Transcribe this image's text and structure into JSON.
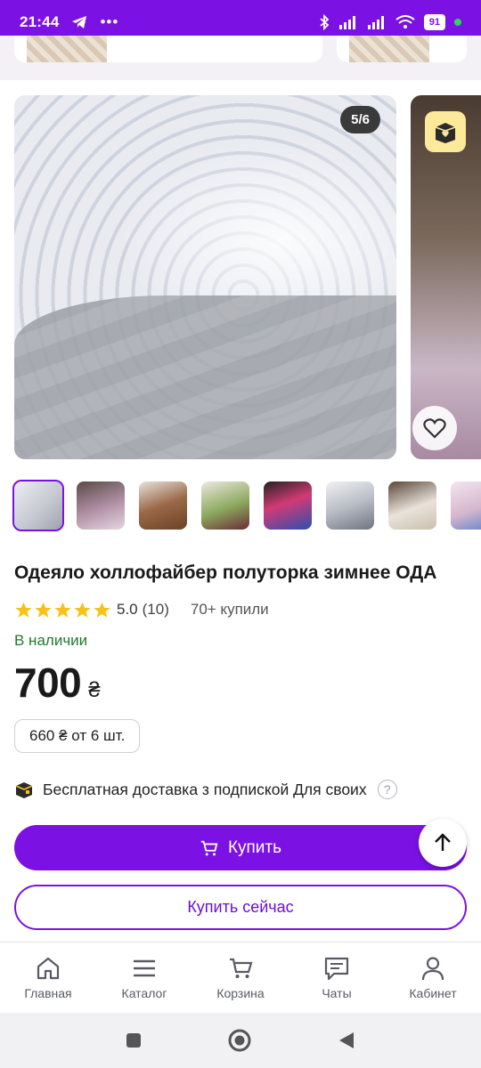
{
  "status_bar": {
    "time": "21:44",
    "battery": "91"
  },
  "gallery": {
    "counter": "5/6",
    "thumbnails": [
      {
        "color": "#d5d7de"
      },
      {
        "color": "#8d6f7f"
      },
      {
        "color": "#8a5a3f"
      },
      {
        "color": "#7e9a55"
      },
      {
        "color": "#c23c6d"
      },
      {
        "color": "#b4b8c0"
      },
      {
        "color": "#d9d2c4"
      },
      {
        "color": "#d7bfd3"
      }
    ]
  },
  "product": {
    "title": "Одеяло холлофайбер полуторка зимнее ОДА",
    "rating": "5.0",
    "rating_count": "(10)",
    "bought": "70+ купили",
    "availability": "В наличии",
    "price": "700",
    "currency": "₴",
    "bulk_price": "660 ₴ от 6 шт."
  },
  "delivery": {
    "text": "Бесплатная доставка з подпиской Для своих",
    "help": "?"
  },
  "buttons": {
    "buy": "Купить",
    "buy_now": "Купить сейчас"
  },
  "colors": {
    "accent": "#7b11e3",
    "in_stock": "#1f7a2c",
    "star": "#f6c21a"
  },
  "nav": {
    "home": "Главная",
    "catalog": "Каталог",
    "cart": "Корзина",
    "chats": "Чаты",
    "profile": "Кабинет"
  }
}
